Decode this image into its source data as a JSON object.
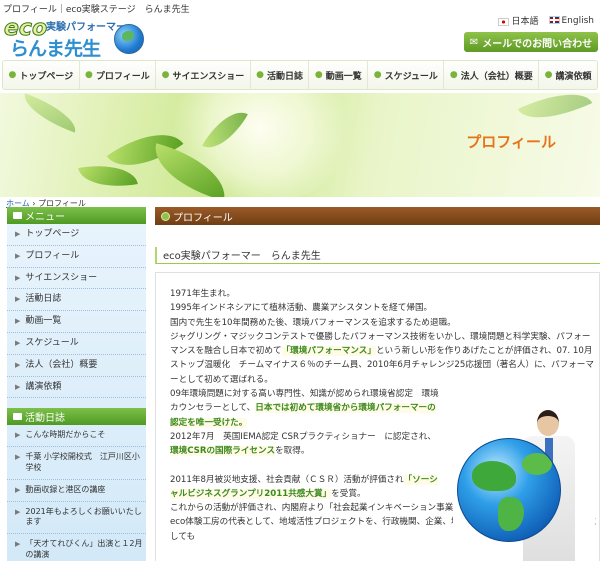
{
  "topbar": {
    "text": "プロフィール｜eco実験ステージ　らんま先生"
  },
  "logo": {
    "eco": "eco",
    "sub": "実験パフォーマー",
    "main": "らんま先生"
  },
  "langs": {
    "ja": "日本語",
    "en": "English"
  },
  "mail_button": {
    "label": "メールでのお問い合わせ",
    "icon": "mail-icon"
  },
  "gnav": [
    {
      "label": "トップページ"
    },
    {
      "label": "プロフィール"
    },
    {
      "label": "サイエンスショー"
    },
    {
      "label": "活動日誌"
    },
    {
      "label": "動画一覧"
    },
    {
      "label": "スケジュール"
    },
    {
      "label": "法人（会社）概要"
    },
    {
      "label": "講演依頼"
    }
  ],
  "hero": {
    "title": "プロフィール"
  },
  "breadcrumb": {
    "home": "ホーム",
    "sep": " › ",
    "current": "プロフィール"
  },
  "sidebar": {
    "menu_title": "メニュー",
    "menu": [
      {
        "label": "トップページ"
      },
      {
        "label": "プロフィール"
      },
      {
        "label": "サイエンスショー"
      },
      {
        "label": "活動日誌"
      },
      {
        "label": "動画一覧"
      },
      {
        "label": "スケジュール"
      },
      {
        "label": "法人（会社）概要"
      },
      {
        "label": "講演依頼"
      }
    ],
    "news_title": "活動日誌",
    "news": [
      {
        "label": "こんな時期だからこそ"
      },
      {
        "label": "千葉 小学校開校式　江戸川区小学校"
      },
      {
        "label": "動画収録と港区の講座"
      },
      {
        "label": "2021年もよろしくお願いいたします"
      },
      {
        "label": "「天才てれびくん」出演と１2月の講演"
      }
    ]
  },
  "main": {
    "title": "プロフィール",
    "subtitle": "eco実験パフォーマー　らんま先生",
    "lines": {
      "l1": "1971年生まれ。",
      "l2": "1995年インドネシアにて植林活動、農業アシスタントを経て帰国。",
      "l3": "国内で先生を10年間務めた後、環境パフォーマンスを追求するため退職。",
      "l4a": "ジャグリング・マジックコンテストで優勝したパフォーマンス技術をいかし、環境問題と科学実験、パフォーマンスを融合し日本で初めて",
      "l4hl": "「環境パフォーマンス」",
      "l4b": "という新しい形を作りあげたことが評価され、07. 10月ストップ温暖化　チームマイナス６％のチーム員、2010年6月チャレンジ25応援団（著名人）に、パフォーマーとして初めて選ばれる。",
      "l5a": "09年環境問題に対する高い専門性、知識が認められ環境省認定　環境カウンセラーとして、",
      "l5hl": "日本では初めて環境省から環境パフォーマーの認定を唯一受けた。",
      "l6a": "2012年7月　英国IEMA認定 CSRプラクティショナー　に認定され、",
      "l6hl": "環境CSRの国際ライセンス",
      "l6b": "を取得。",
      "l7a": "2011年8月被災地支援、社会貢献（ＣＳＲ）活動が評価され",
      "l7hl": "「ソーシャルビジネスグランプリ2011共感大賞」",
      "l7b": "を受賞。",
      "l8": "これからの活動が評価され、内閣府より「社会起業インキベーション事業」の認定を受け、現在、NPO法人eco体験工房の代表として、地域活性プロジェクトを、行政機関、企業、地域と連携したCSRプロデューサーとしても"
    }
  },
  "colors": {
    "accent": "#e8731a",
    "green": "#5e9a24",
    "brown": "#7a4518",
    "link": "#2a63b8"
  }
}
